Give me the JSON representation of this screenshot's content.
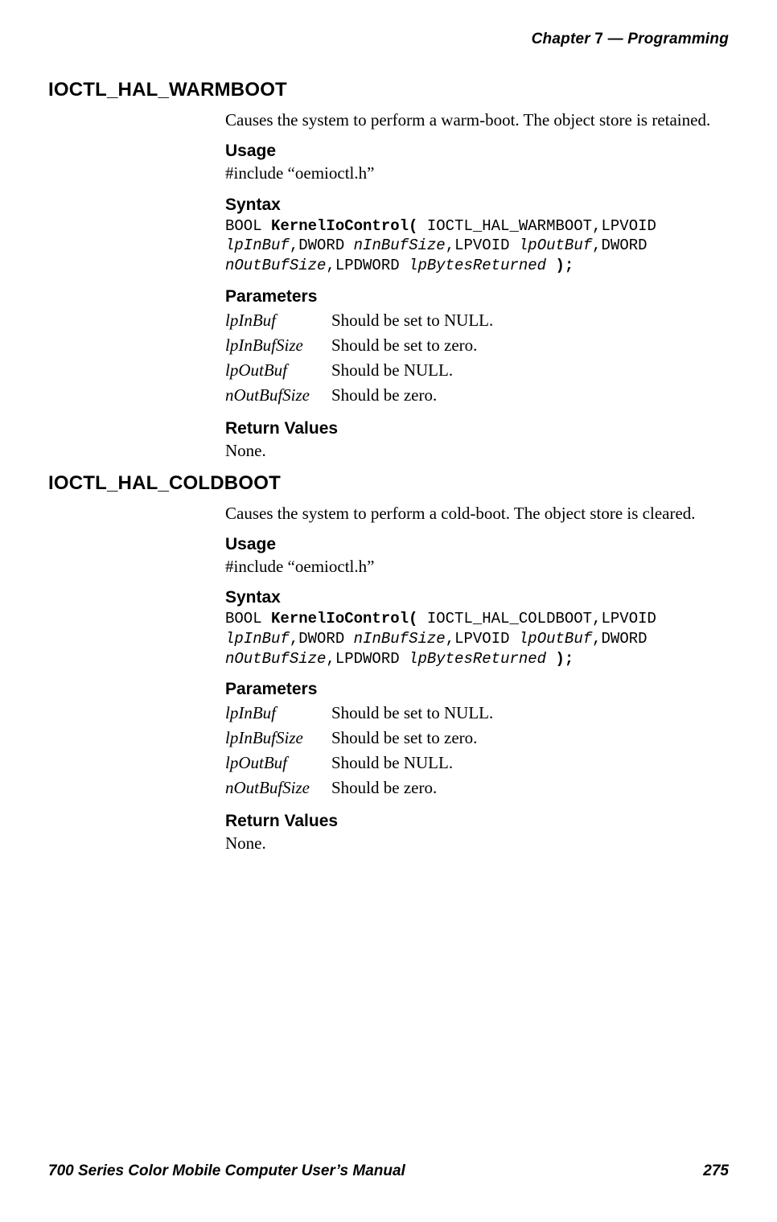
{
  "header": {
    "chapter_label": "Chapter",
    "chapter_number": "7",
    "dash": "—",
    "chapter_title": "Programming"
  },
  "sections": [
    {
      "title": "IOCTL_HAL_WARMBOOT",
      "desc": "Causes the system to perform a warm-boot. The object store is retained.",
      "usage_h": "Usage",
      "usage": "#include “oemioctl.h”",
      "syntax_h": "Syntax",
      "syntax": {
        "t1": "BOOL ",
        "b1": "KernelIoControl(",
        "t2": " IOCTL_HAL_WARMBOOT,LPVOID ",
        "i1": "lpInBuf",
        "t3": ",DWORD ",
        "i2": "nInBufSize",
        "t4": ",LPVOID ",
        "i3": "lpOutBuf",
        "t5": ",DWORD ",
        "i4": "nOutBufSize",
        "t6": ",LPDWORD ",
        "i5": "lpBytesReturned",
        "t7": " ",
        "b2": ");"
      },
      "params_h": "Parameters",
      "params": [
        {
          "name": "lpInBuf",
          "desc": "Should be set to NULL."
        },
        {
          "name": "lpInBufSize",
          "desc": "Should be set to zero."
        },
        {
          "name": "lpOutBuf",
          "desc": "Should be NULL."
        },
        {
          "name": "nOutBufSize",
          "desc": "Should be zero."
        }
      ],
      "return_h": "Return Values",
      "return": "None."
    },
    {
      "title": "IOCTL_HAL_COLDBOOT",
      "desc": "Causes the system to perform a cold-boot. The object store is cleared.",
      "usage_h": "Usage",
      "usage": "#include “oemioctl.h”",
      "syntax_h": "Syntax",
      "syntax": {
        "t1": "BOOL ",
        "b1": "KernelIoControl(",
        "t2": " IOCTL_HAL_COLDBOOT,LPVOID ",
        "i1": "lpInBuf",
        "t3": ",DWORD ",
        "i2": "nInBufSize",
        "t4": ",LPVOID ",
        "i3": "lpOutBuf",
        "t5": ",DWORD ",
        "i4": "nOutBufSize",
        "t6": ",LPDWORD ",
        "i5": "lpBytesReturned",
        "t7": " ",
        "b2": ");"
      },
      "params_h": "Parameters",
      "params": [
        {
          "name": "lpInBuf",
          "desc": "Should be set to NULL."
        },
        {
          "name": "lpInBufSize",
          "desc": "Should be set to zero."
        },
        {
          "name": "lpOutBuf",
          "desc": "Should be NULL."
        },
        {
          "name": "nOutBufSize",
          "desc": "Should be zero."
        }
      ],
      "return_h": "Return Values",
      "return": "None."
    }
  ],
  "footer": {
    "manual_title": "700 Series Color Mobile Computer User’s Manual",
    "page_number": "275"
  }
}
